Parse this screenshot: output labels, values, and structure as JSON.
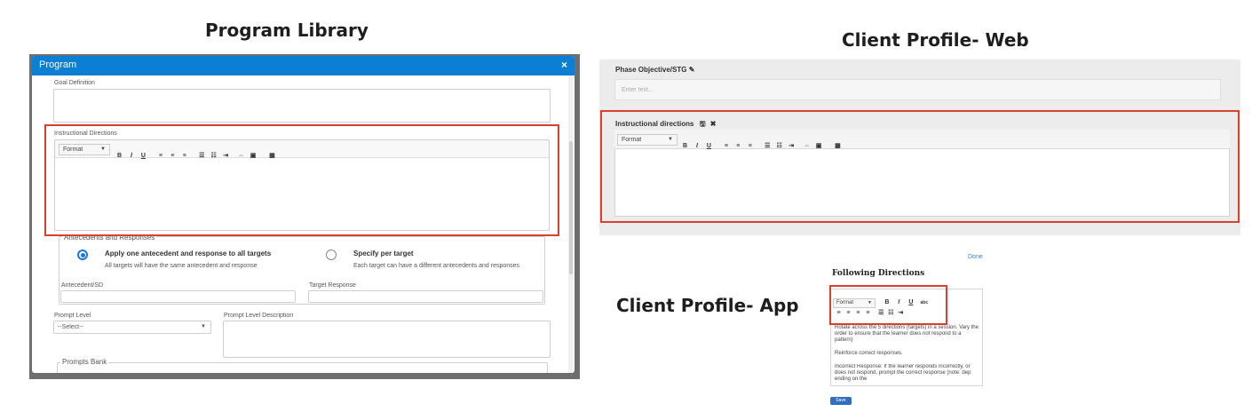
{
  "headings": {
    "program_library": "Program Library",
    "client_profile_web": "Client Profile- Web",
    "client_profile_app": "Client Profile- App"
  },
  "program_dialog": {
    "title": "Program",
    "close": "×",
    "goal_definition_label": "Goal Definition",
    "instructional_directions_label": "Instructional Directions",
    "toolbar": {
      "format": "Format",
      "bold": "B",
      "italic": "I",
      "underline": "U"
    },
    "antecedents_legend": "Antecedents and Responses",
    "option_one_title": "Apply one antecedent and response to all targets",
    "option_one_desc": "All targets will have the same antecedent and response",
    "option_two_title": "Specify per target",
    "option_two_desc": "Each target can have a different antecedents and responses",
    "antecedent_label": "Antecedent/SD",
    "target_response_label": "Target Response",
    "prompt_level_label": "Prompt Level",
    "prompt_level_value": "--Select--",
    "prompt_level_desc_label": "Prompt Level Description",
    "prompts_bank_legend": "Prompts Bank"
  },
  "web": {
    "phase_label": "Phase Objective/STG",
    "phase_placeholder": "Enter text...",
    "instructional_label": "Instructional directions",
    "toolbar": {
      "format": "Format",
      "bold": "B",
      "italic": "I",
      "underline": "U"
    }
  },
  "app": {
    "done": "Done",
    "title": "Following Directions",
    "toolbar": {
      "format": "Format",
      "bold": "B",
      "italic": "I",
      "underline": "U",
      "strike": "abc"
    },
    "para1": "Rotate across the 5 directions (targets) in a session. Vary the order to ensure that the learner does not respond to a pattern)",
    "para2": "Reinforce correct responses.",
    "para3": "Incorrect Response: If the learner responds incorrectly, or does not respond, prompt the correct response (note: dep ending on the",
    "save": "Save"
  },
  "colors": {
    "accent_blue": "#0a7fd4",
    "highlight_red": "#d9412e"
  }
}
